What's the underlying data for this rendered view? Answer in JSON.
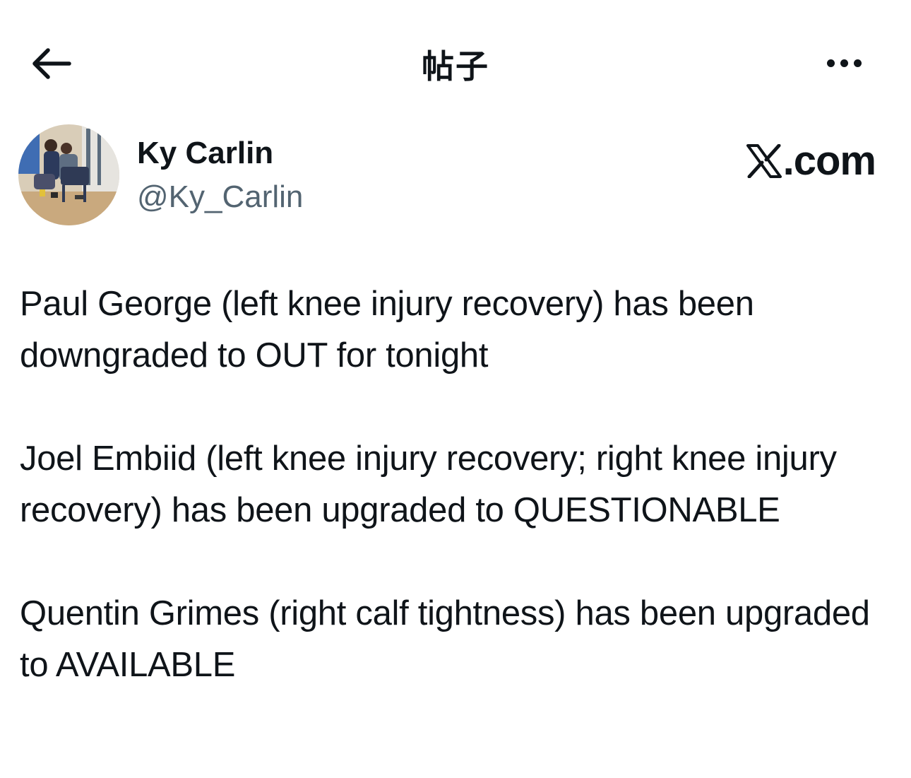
{
  "header": {
    "title": "帖子",
    "back_icon": "arrow-left-icon",
    "more_icon": "more-horizontal-icon"
  },
  "author": {
    "name": "Ky Carlin",
    "handle": "@Ky_Carlin",
    "avatar_icon": "avatar-photo"
  },
  "source": {
    "brand": ".com",
    "logo_icon": "x-logo-icon"
  },
  "post": {
    "paragraphs": [
      "Paul George (left knee injury recovery) has been downgraded to OUT for tonight",
      "Joel Embiid (left knee injury recovery; right knee injury recovery) has been upgraded to QUESTIONABLE",
      "Quentin Grimes (right calf tightness) has been upgraded to AVAILABLE"
    ]
  },
  "colors": {
    "text_primary": "#0f1419",
    "text_secondary": "#536471",
    "background": "#ffffff"
  }
}
